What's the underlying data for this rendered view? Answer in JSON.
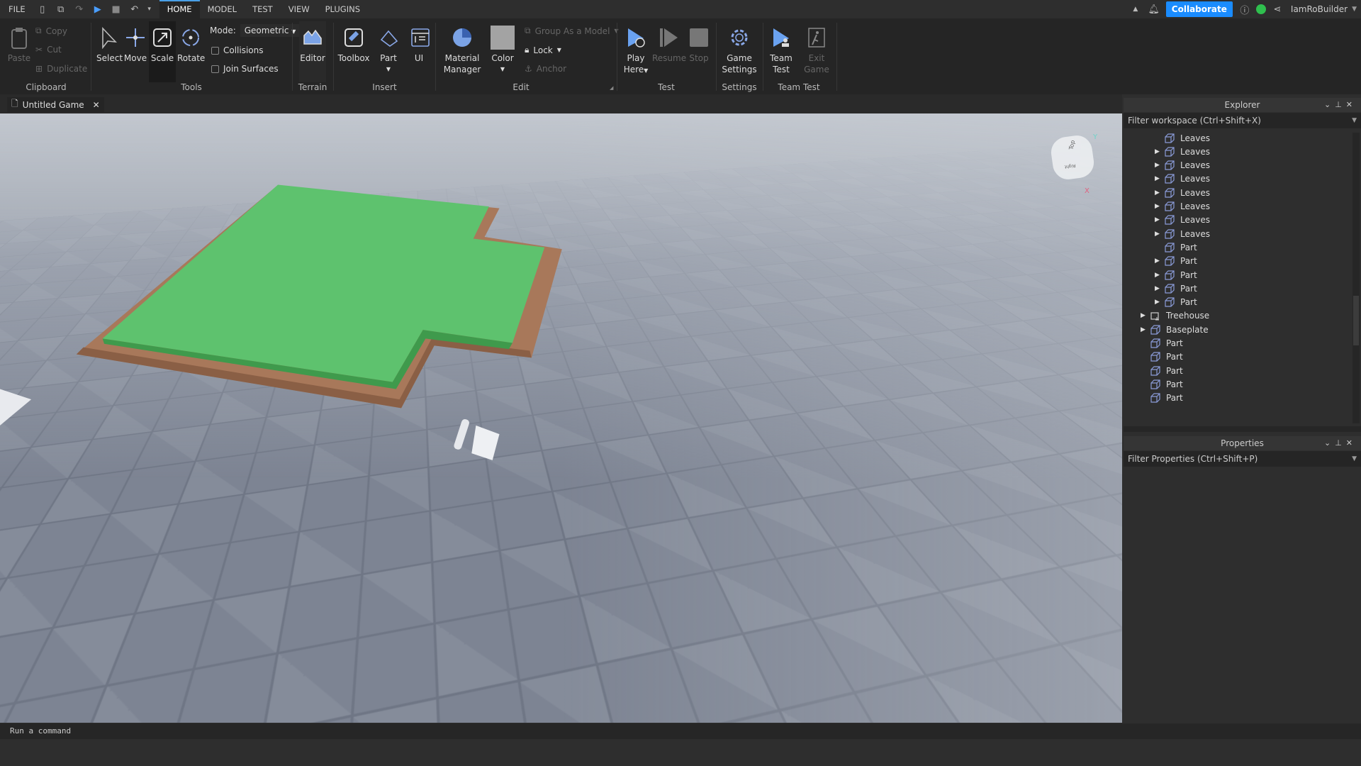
{
  "menu": {
    "file": "FILE",
    "tabs": [
      "HOME",
      "MODEL",
      "TEST",
      "VIEW",
      "PLUGINS"
    ],
    "active_tab": "HOME"
  },
  "account": {
    "collaborate": "Collaborate",
    "username": "IamRoBuilder",
    "accent": "#1a8cff"
  },
  "ribbon": {
    "clipboard": {
      "paste": "Paste",
      "copy": "Copy",
      "cut": "Cut",
      "duplicate": "Duplicate",
      "group": "Clipboard"
    },
    "tools": {
      "select": "Select",
      "move": "Move",
      "scale": "Scale",
      "rotate": "Rotate",
      "mode_label": "Mode:",
      "mode_value": "Geometric",
      "collisions": "Collisions",
      "join_surfaces": "Join Surfaces",
      "group": "Tools"
    },
    "terrain": {
      "editor": "Editor",
      "group": "Terrain"
    },
    "insert": {
      "toolbox": "Toolbox",
      "part": "Part",
      "ui": "UI",
      "group": "Insert"
    },
    "edit": {
      "material_1": "Material",
      "material_2": "Manager",
      "color": "Color",
      "group_as_model": "Group As a Model",
      "lock": "Lock",
      "anchor": "Anchor",
      "group": "Edit"
    },
    "test": {
      "play_1": "Play",
      "play_2": "Here",
      "resume": "Resume",
      "stop": "Stop",
      "group": "Test"
    },
    "settings": {
      "game_1": "Game",
      "game_2": "Settings",
      "group": "Settings"
    },
    "team_test": {
      "team_1": "Team",
      "team_2": "Test",
      "exit_1": "Exit",
      "exit_2": "Game",
      "group": "Team Test"
    }
  },
  "document_tab": {
    "title": "Untitled Game"
  },
  "viewport": {
    "view_cube_top": "Top",
    "view_cube_front": "Right",
    "axis_y": "Y",
    "axis_x": "X",
    "platform_color": "#5ec26e",
    "dirt_color": "#a8785a"
  },
  "explorer": {
    "title": "Explorer",
    "filter_placeholder": "Filter workspace (Ctrl+Shift+X)",
    "items": [
      {
        "label": "Leaves",
        "level": 2,
        "expandable": false
      },
      {
        "label": "Leaves",
        "level": 2,
        "expandable": true
      },
      {
        "label": "Leaves",
        "level": 2,
        "expandable": true
      },
      {
        "label": "Leaves",
        "level": 2,
        "expandable": true
      },
      {
        "label": "Leaves",
        "level": 2,
        "expandable": true
      },
      {
        "label": "Leaves",
        "level": 2,
        "expandable": true
      },
      {
        "label": "Leaves",
        "level": 2,
        "expandable": true
      },
      {
        "label": "Leaves",
        "level": 2,
        "expandable": true
      },
      {
        "label": "Part",
        "level": 2,
        "expandable": false
      },
      {
        "label": "Part",
        "level": 2,
        "expandable": true
      },
      {
        "label": "Part",
        "level": 2,
        "expandable": true
      },
      {
        "label": "Part",
        "level": 2,
        "expandable": true
      },
      {
        "label": "Part",
        "level": 2,
        "expandable": true
      },
      {
        "label": "Treehouse",
        "level": 1,
        "expandable": true,
        "icon": "model-icon"
      },
      {
        "label": "Baseplate",
        "level": 1,
        "expandable": true
      },
      {
        "label": "Part",
        "level": 1,
        "expandable": false
      },
      {
        "label": "Part",
        "level": 1,
        "expandable": false
      },
      {
        "label": "Part",
        "level": 1,
        "expandable": false
      },
      {
        "label": "Part",
        "level": 1,
        "expandable": false
      },
      {
        "label": "Part",
        "level": 1,
        "expandable": false
      }
    ]
  },
  "properties": {
    "title": "Properties",
    "filter_placeholder": "Filter Properties (Ctrl+Shift+P)"
  },
  "command_bar": {
    "placeholder": "Run a command"
  }
}
